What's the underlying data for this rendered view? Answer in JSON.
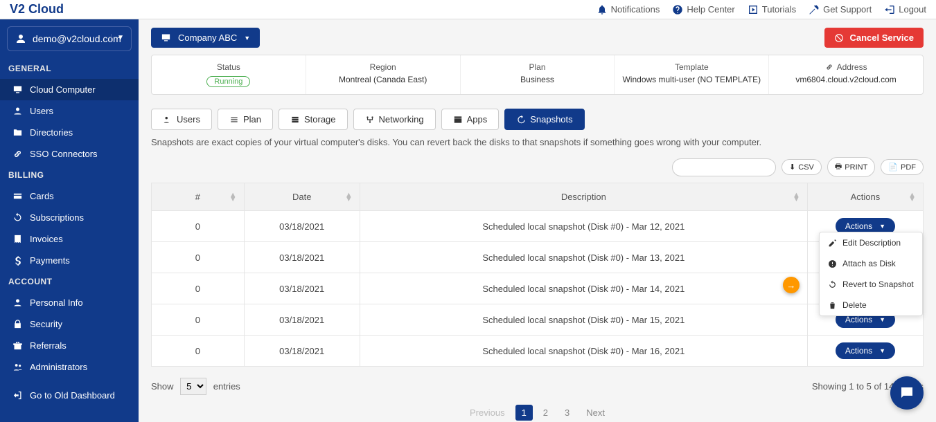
{
  "app": {
    "logo": "V2 Cloud"
  },
  "topbar": {
    "notifications": "Notifications",
    "help": "Help Center",
    "tutorials": "Tutorials",
    "support": "Get Support",
    "logout": "Logout"
  },
  "user": {
    "email": "demo@v2cloud.com"
  },
  "sidebar": {
    "sections": {
      "general": "GENERAL",
      "billing": "BILLING",
      "account": "ACCOUNT"
    },
    "items": {
      "cloud": "Cloud Computer",
      "users": "Users",
      "directories": "Directories",
      "sso": "SSO Connectors",
      "cards": "Cards",
      "subscriptions": "Subscriptions",
      "invoices": "Invoices",
      "payments": "Payments",
      "personal": "Personal Info",
      "security": "Security",
      "referrals": "Referrals",
      "admins": "Administrators",
      "olddash": "Go to Old Dashboard"
    }
  },
  "company_dd": "Company ABC",
  "cancel_service": "Cancel Service",
  "info": {
    "status_label": "Status",
    "status_value": "Running",
    "region_label": "Region",
    "region_value": "Montreal (Canada East)",
    "plan_label": "Plan",
    "plan_value": "Business",
    "template_label": "Template",
    "template_value": "Windows multi-user (NO TEMPLATE)",
    "address_label": "Address",
    "address_value": "vm6804.cloud.v2cloud.com"
  },
  "tabs": {
    "users": "Users",
    "plan": "Plan",
    "storage": "Storage",
    "networking": "Networking",
    "apps": "Apps",
    "snapshots": "Snapshots"
  },
  "snapshot_desc": "Snapshots are exact copies of your virtual computer's disks. You can revert back the disks to that snapshots if something goes wrong with your computer.",
  "export": {
    "csv": "CSV",
    "print": "PRINT",
    "pdf": "PDF"
  },
  "table": {
    "headers": {
      "num": "#",
      "date": "Date",
      "desc": "Description",
      "actions": "Actions"
    },
    "rows": [
      {
        "num": "0",
        "date": "03/18/2021",
        "desc": "Scheduled local snapshot (Disk #0) - Mar 12, 2021"
      },
      {
        "num": "0",
        "date": "03/18/2021",
        "desc": "Scheduled local snapshot (Disk #0) - Mar 13, 2021"
      },
      {
        "num": "0",
        "date": "03/18/2021",
        "desc": "Scheduled local snapshot (Disk #0) - Mar 14, 2021"
      },
      {
        "num": "0",
        "date": "03/18/2021",
        "desc": "Scheduled local snapshot (Disk #0) - Mar 15, 2021"
      },
      {
        "num": "0",
        "date": "03/18/2021",
        "desc": "Scheduled local snapshot (Disk #0) - Mar 16, 2021"
      }
    ],
    "actions_label": "Actions"
  },
  "dropdown": {
    "edit": "Edit Description",
    "attach": "Attach as Disk",
    "revert": "Revert to Snapshot",
    "delete": "Delete"
  },
  "footer": {
    "show": "Show",
    "entries": "entries",
    "select_value": "5",
    "showing": "Showing 1 to 5 of 14 entries",
    "prev": "Previous",
    "p1": "1",
    "p2": "2",
    "p3": "3",
    "next": "Next"
  }
}
